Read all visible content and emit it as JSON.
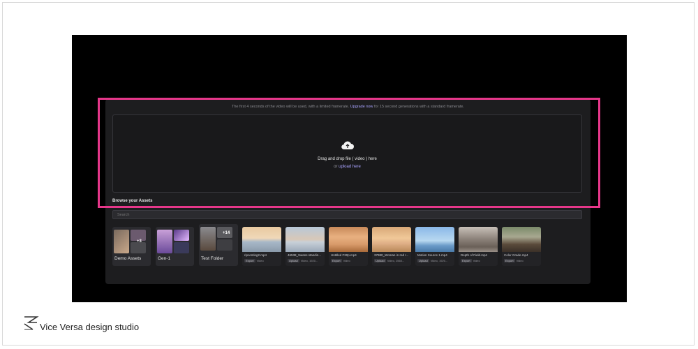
{
  "notice": {
    "text": "The first 4 seconds of the video will be used, with a limited framerate.",
    "link": "Upgrade now",
    "text_after": "for 15 second generations with a standard framerate."
  },
  "dropzone": {
    "title": "Drag and drop file ( video ) here",
    "sub_prefix": "or",
    "sub_link": "upload here",
    "icon": "cloud-upload-icon"
  },
  "browse": {
    "title": "Browse your Assets",
    "search_placeholder": "Search"
  },
  "folders": [
    {
      "name": "Demo Assets",
      "count": "+3"
    },
    {
      "name": "Gen-1",
      "count": ""
    },
    {
      "name": "Test Folder",
      "count": "+14"
    }
  ],
  "videos": [
    {
      "name": "ripcenting2.mp4",
      "badge": "Export",
      "meta": "Video"
    },
    {
      "name": "46538_Swans standin...",
      "badge": "Upload",
      "meta": "Video, 1920..."
    },
    {
      "name": "Untitled F30p.mp4",
      "badge": "Export",
      "meta": "Video"
    },
    {
      "name": "37980_Woman in red r...",
      "badge": "Upload",
      "meta": "Video, 2560..."
    },
    {
      "name": "Motion Source 1.mp4",
      "badge": "Upload",
      "meta": "Video, 1920..."
    },
    {
      "name": "Depth of Field.mp4",
      "badge": "Export",
      "meta": "Video"
    },
    {
      "name": "Color Grade.mp4",
      "badge": "Export",
      "meta": "Video"
    }
  ],
  "branding": {
    "studio": "Vice Versa design studio"
  },
  "colors": {
    "highlight": "#e6378a",
    "accent_link": "#a9a3ff",
    "panel": "#1d1d1f"
  }
}
